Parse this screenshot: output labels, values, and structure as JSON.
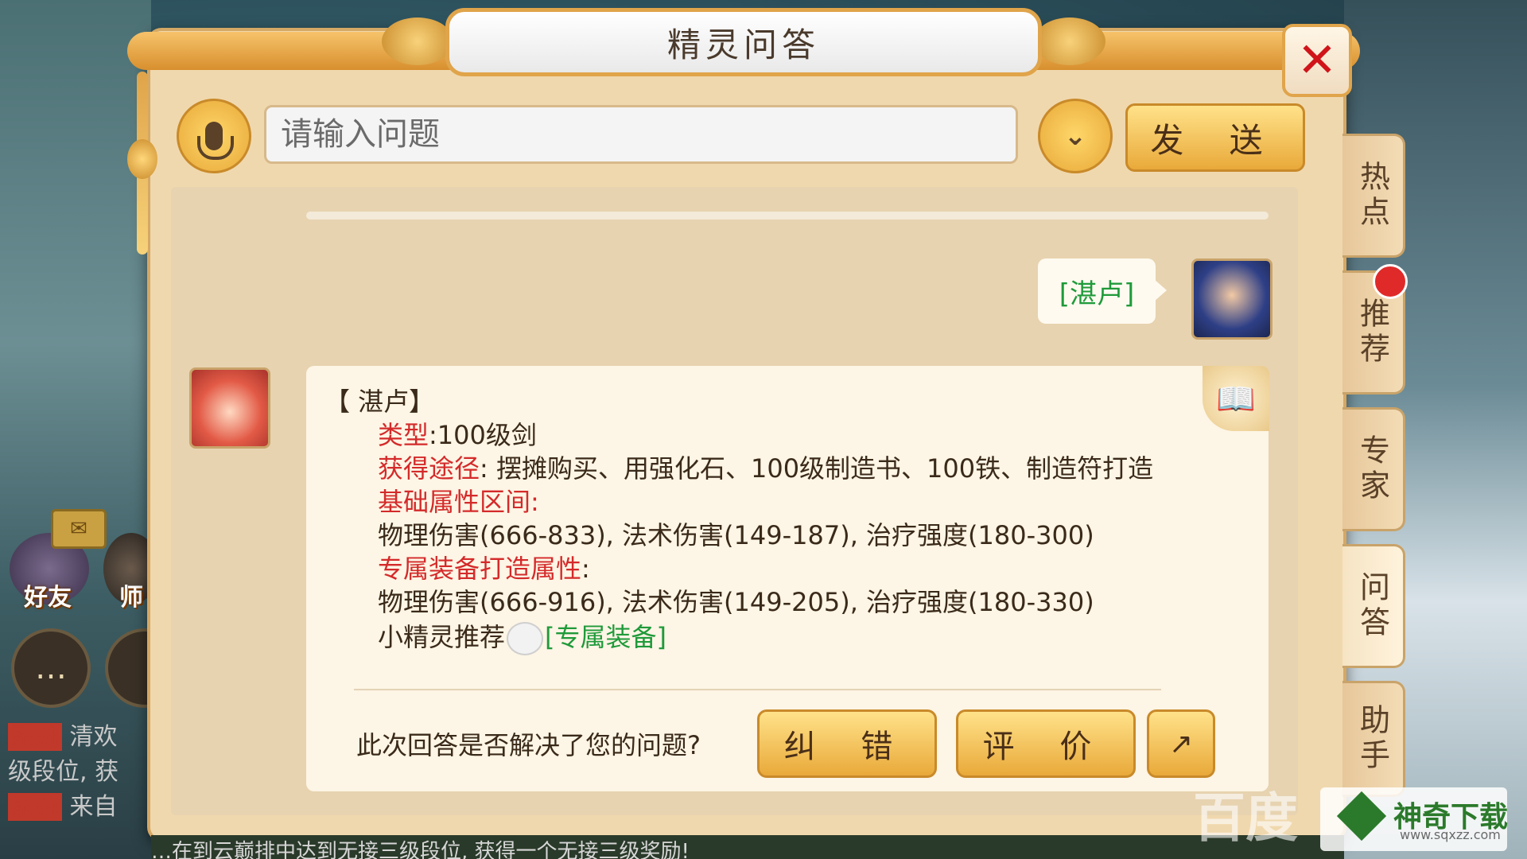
{
  "dialog": {
    "title": "精灵问答",
    "close_icon": "close-icon"
  },
  "input": {
    "placeholder": "请输入问题",
    "value": "",
    "send_label": "发 送",
    "dropdown_glyph": "⌄"
  },
  "conversation": {
    "user_message": "[湛卢]",
    "answer": {
      "title": "【 湛卢】",
      "type_label": "类型",
      "type_value": ":100级剑",
      "source_label": "获得途径",
      "source_value": ": 摆摊购买、用强化石、100级制造书、100铁、制造符打造",
      "base_label": "基础属性区间:",
      "base_value": "物理伤害(666-833), 法术伤害(149-187), 治疗强度(180-300)",
      "exclusive_label": "专属装备打造属性",
      "exclusive_colon": ":",
      "exclusive_value": "物理伤害(666-916), 法术伤害(149-205), 治疗强度(180-330)",
      "recommend_text": "小精灵推荐",
      "recommend_link": "[专属装备]"
    },
    "feedback_question": "此次回答是否解决了您的问题?",
    "correct_label": "纠 错",
    "rate_label": "评 价"
  },
  "side_tabs": [
    {
      "label": "热点"
    },
    {
      "label": "推荐"
    },
    {
      "label": "专家"
    },
    {
      "label": "问答"
    },
    {
      "label": "助手"
    }
  ],
  "background_ui": {
    "friend_label": "好友",
    "master_label": "师",
    "chat_lines": [
      "清欢",
      "级段位, 获",
      "来自"
    ],
    "bottom_news": "…在到云巅排中达到无接三级段位, 获得一个无接三级奖励!"
  },
  "watermark": {
    "baidu": "百度",
    "site_name": "神奇下载",
    "site_url": "www.sqxzz.com"
  },
  "colors": {
    "highlight_red": "#d42a2a",
    "link_green": "#1f9a3a",
    "button_gold": "#e9a93a"
  }
}
